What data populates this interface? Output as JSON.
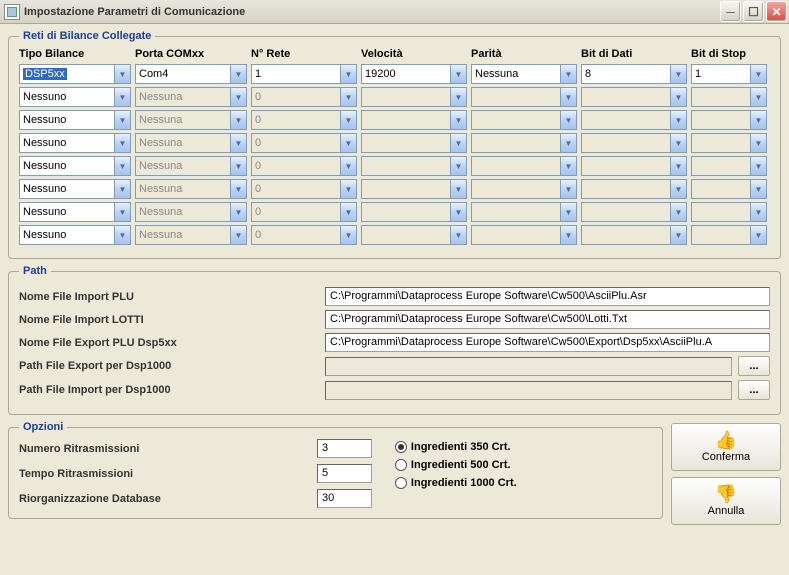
{
  "window": {
    "title": "Impostazione Parametri di Comunicazione"
  },
  "reti": {
    "legend": "Reti di Bilance Collegate",
    "headers": {
      "tipo": "Tipo Bilance",
      "porta": "Porta COMxx",
      "rete": "N° Rete",
      "velocita": "Velocità",
      "parita": "Parità",
      "dati": "Bit di Dati",
      "stop": "Bit di Stop"
    },
    "rows": [
      {
        "tipo": "DSP5xx",
        "porta": "Com4",
        "rete": "1",
        "velocita": "19200",
        "parita": "Nessuna",
        "dati": "8",
        "stop": "1",
        "active": true,
        "selected": true
      },
      {
        "tipo": "Nessuno",
        "porta": "Nessuna",
        "rete": "0",
        "velocita": "",
        "parita": "",
        "dati": "",
        "stop": "",
        "active": false
      },
      {
        "tipo": "Nessuno",
        "porta": "Nessuna",
        "rete": "0",
        "velocita": "",
        "parita": "",
        "dati": "",
        "stop": "",
        "active": false
      },
      {
        "tipo": "Nessuno",
        "porta": "Nessuna",
        "rete": "0",
        "velocita": "",
        "parita": "",
        "dati": "",
        "stop": "",
        "active": false
      },
      {
        "tipo": "Nessuno",
        "porta": "Nessuna",
        "rete": "0",
        "velocita": "",
        "parita": "",
        "dati": "",
        "stop": "",
        "active": false
      },
      {
        "tipo": "Nessuno",
        "porta": "Nessuna",
        "rete": "0",
        "velocita": "",
        "parita": "",
        "dati": "",
        "stop": "",
        "active": false
      },
      {
        "tipo": "Nessuno",
        "porta": "Nessuna",
        "rete": "0",
        "velocita": "",
        "parita": "",
        "dati": "",
        "stop": "",
        "active": false
      },
      {
        "tipo": "Nessuno",
        "porta": "Nessuna",
        "rete": "0",
        "velocita": "",
        "parita": "",
        "dati": "",
        "stop": "",
        "active": false
      }
    ]
  },
  "path": {
    "legend": "Path",
    "rows": [
      {
        "label": "Nome File Import PLU",
        "value": "C:\\Programmi\\Dataprocess Europe Software\\Cw500\\AsciiPlu.Asr",
        "browse": false,
        "enabled": true
      },
      {
        "label": "Nome File Import LOTTI",
        "value": "C:\\Programmi\\Dataprocess Europe Software\\Cw500\\Lotti.Txt",
        "browse": false,
        "enabled": true
      },
      {
        "label": "Nome File Export PLU Dsp5xx",
        "value": "C:\\Programmi\\Dataprocess Europe Software\\Cw500\\Export\\Dsp5xx\\AsciiPlu.A",
        "browse": false,
        "enabled": true
      },
      {
        "label": "Path File Export per Dsp1000",
        "value": "",
        "browse": true,
        "enabled": false
      },
      {
        "label": "Path File Import per Dsp1000",
        "value": "",
        "browse": true,
        "enabled": false
      }
    ]
  },
  "opzioni": {
    "legend": "Opzioni",
    "fields": [
      {
        "label": "Numero Ritrasmissioni",
        "value": "3"
      },
      {
        "label": "Tempo Ritrasmissioni",
        "value": "5"
      },
      {
        "label": "Riorganizzazione Database",
        "value": "30"
      }
    ],
    "radios": [
      {
        "label": "Ingredienti 350 Crt.",
        "checked": true
      },
      {
        "label": "Ingredienti 500 Crt.",
        "checked": false
      },
      {
        "label": "Ingredienti 1000 Crt.",
        "checked": false
      }
    ]
  },
  "buttons": {
    "confirm": "Conferma",
    "cancel": "Annulla",
    "browse": "..."
  }
}
